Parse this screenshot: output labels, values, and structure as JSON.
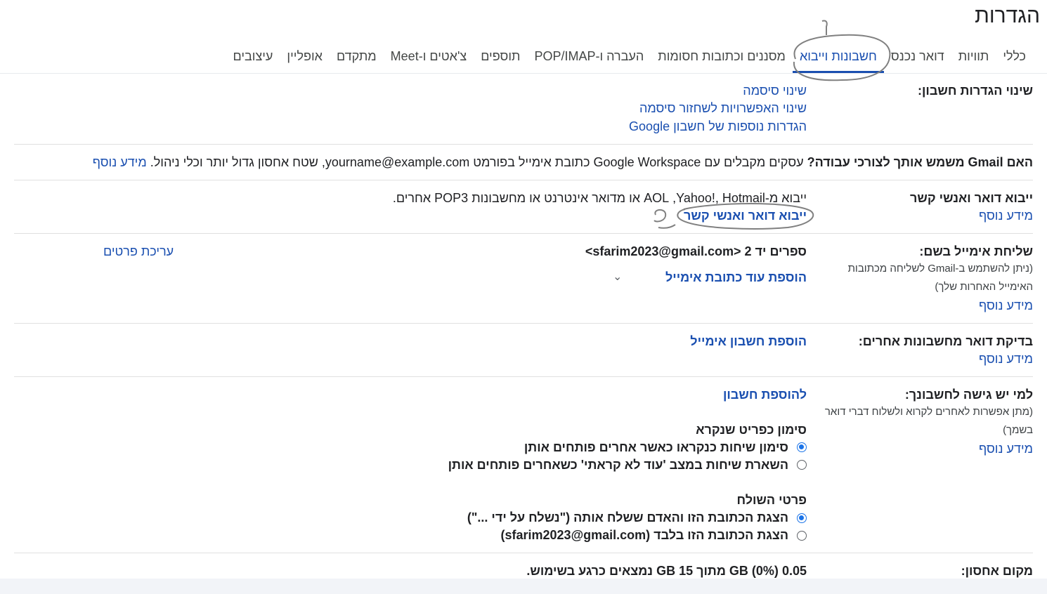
{
  "page": {
    "title": "הגדרות"
  },
  "tabs": [
    {
      "label": "כללי"
    },
    {
      "label": "תוויות"
    },
    {
      "label": "דואר נכנס"
    },
    {
      "label": "חשבונות וייבוא"
    },
    {
      "label": "מסננים וכתובות חסומות"
    },
    {
      "label": "העברה ו-POP/IMAP"
    },
    {
      "label": "תוספים"
    },
    {
      "label": "צ'אטים ו-Meet"
    },
    {
      "label": "מתקדם"
    },
    {
      "label": "אופליין"
    },
    {
      "label": "עיצובים"
    }
  ],
  "account_settings": {
    "label": "שינוי הגדרות חשבון:",
    "links": [
      "שינוי סיסמה",
      "שינוי האפשרויות לשחזור סיסמה",
      "הגדרות נוספות של חשבון Google"
    ]
  },
  "workspace": {
    "question": "האם Gmail משמש אותך לצורכי עבודה?",
    "text": " עסקים מקבלים עם Google Workspace כתובת אימייל בפורמט yourname@example.com, שטח אחסון גדול יותר וכלי ניהול.",
    "learn_more": "מידע נוסף"
  },
  "import": {
    "label": "ייבוא דואר ואנשי קשר",
    "learn_more": "מידע נוסף",
    "description": "ייבוא מ-Yahoo!‎, Hotmail‏, AOL או מדואר אינטרנט או מחשבונות POP3 אחרים.",
    "action": "ייבוא דואר ואנשי קשר"
  },
  "send_as": {
    "label": "שליחת אימייל בשם:",
    "note": "(ניתן להשתמש ב-Gmail לשליחה מכתובות האימייל האחרות שלך)",
    "learn_more": "מידע נוסף",
    "address": "ספרים יד 2 <sfarim2023@gmail.com>",
    "edit": "עריכת פרטים",
    "add_another": "הוספת עוד כתובת אימייל"
  },
  "check_mail": {
    "label": "בדיקת דואר מחשבונות אחרים:",
    "learn_more": "מידע נוסף",
    "add_account": "הוספת חשבון אימייל"
  },
  "grant_access": {
    "label": "למי יש גישה לחשבונך:",
    "note": "(מתן אפשרות לאחרים לקרוא ולשלוח דברי דואר בשמך)",
    "learn_more": "מידע נוסף",
    "add_account": "להוספת חשבון",
    "mark_read_heading": "סימון כפריט שנקרא",
    "mark_read_options": [
      {
        "label": "סימון שיחות כנקראו כאשר אחרים פותחים אותן",
        "selected": true
      },
      {
        "label": "השארת שיחות במצב 'עוד לא קראתי' כשאחרים פותחים אותן",
        "selected": false
      }
    ],
    "sender_heading": "פרטי השולח",
    "sender_options": [
      {
        "label": "הצגת הכתובת הזו והאדם ששלח אותה (\"נשלח על ידי ...\")",
        "selected": true
      },
      {
        "label": "הצגת הכתובת הזו בלבד (sfarim2023@gmail.com)",
        "selected": false
      }
    ]
  },
  "storage": {
    "label": "מקום אחסון:",
    "text": "0.05 GB (0%) מתוך 15 GB נמצאים כרגע בשימוש."
  },
  "annotations": {
    "digit_1": "1",
    "digit_2": "2"
  },
  "colors": {
    "link": "#1a4fb0",
    "radio_on": "#1a73e8",
    "divider": "#e0e0e0"
  }
}
